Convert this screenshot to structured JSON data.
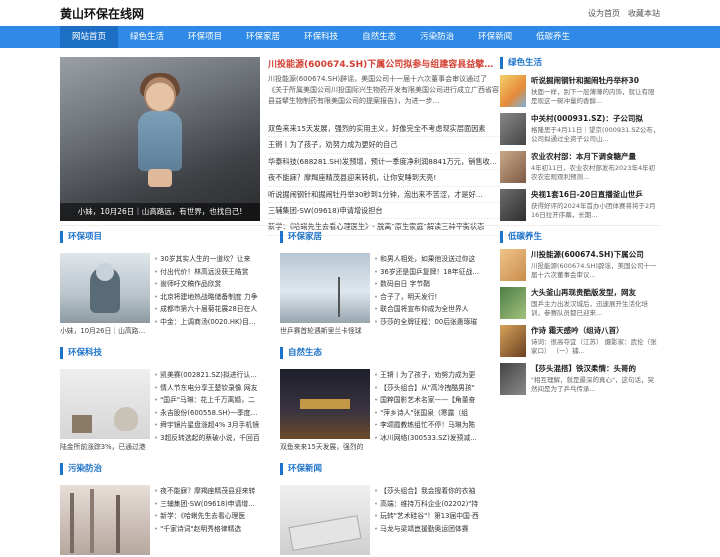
{
  "header": {
    "site_title": "黄山环保在线网",
    "links": [
      "设为首页",
      "收藏本站"
    ]
  },
  "nav": {
    "items": [
      "网站首页",
      "绿色生活",
      "环保项目",
      "环保家居",
      "环保科技",
      "自然生态",
      "污染防治",
      "环保新闻",
      "低碳养生"
    ],
    "active_index": 0
  },
  "featured": {
    "caption": "小妹，10月26日｜山高路远，有世界，也找自己!"
  },
  "headlines": {
    "title": "川投能源(600674.SH)下属公司拟参与组建容县益擘新...",
    "summary": "川投能源(600674.SH)辟谣，美国公司十一届十六次董事会审议通过了《关于所属美国公司川投国际兴生物药开发有限美国公司进行成立广西省容县益擘生物制药有限美国公司的提案报告》，为进一步...",
    "items": [
      "双鱼来来15天发展，强烈的实用主义，好像完全不考虑现实层面因素",
      "王锵丨为了孩子，劝努力成为更好的自己",
      "华泰科技(688281.SH)发预增，预计一季度净利润8841万元，销售收入...",
      "夜不能寐？摩羯座精茂县迎来转机，让你安睡到天亮!",
      "听说掘闹钢针和掘闹牡丹举30秒到1分钟，泡出来不苦涩，才是好...",
      "三辅集团-SW(09618)申请增设担台",
      "新学：《哈蜊先生去看心理医生》- 脱离\"原生家庭\"解读三种平衡状态"
    ]
  },
  "sidebar": {
    "heading": "绿色生活",
    "items": [
      {
        "title": "听说掘闹钢针和掘闹牡丹举杯30",
        "desc": "扶面一样，别下一层薄薄的内饰，就让有限是现这一碗冲量的香醇..."
      },
      {
        "title": "中关村(000931.SZ)：子公司拟",
        "desc": "格隆思于4月11日｜望京(000931.SZ公布，公司拟通过全资子公司山..."
      },
      {
        "title": "农业农村部：本月下调食糖产量",
        "desc": "4年初11日，农业农村部发布2023年4年初农农宏观观利预测..."
      },
      {
        "title": "央视1套16日-20日直播釜山世乒",
        "desc": "获得好评的2024年首办小团体赛将将于2月16日拉开序幕，长期..."
      }
    ]
  },
  "sections": {
    "huanbao_xiangmu": {
      "heading": "环保项目",
      "caption": "小妹，10月26日｜山高路远，",
      "items": [
        "30岁其实人生的一道坎？让来",
        "付出代价！林高远没获王皓赏",
        "崮师吁文稿作品欣赏",
        "北京将建地热战略储备制度 力争",
        "成都市第六十届菊花展28日在人",
        "中金：上调商汤(0020.HK)目标价"
      ]
    },
    "huanbao_jiaju": {
      "heading": "环保家居",
      "caption": "世乒赛首轮遇斯里兰卡怪球",
      "items": [
        "和男人相处，如果他没送过你这",
        "36岁还是国乒复牌！18年征战10",
        "数码自日 字节鞘",
        "合子了，明天发行!",
        "联合国将宣布仰成为全世界人",
        "莎莎的全牌征程：00后张惠琢璀"
      ]
    },
    "huanbao_keji": {
      "heading": "环保科技",
      "caption": "陆金所前涨踪3%，已通过港",
      "items": [
        "凯美赛(002821.SZ)拟进行认购有",
        "情人节东电分享王楚钦录像 网友",
        "\"国乒\"马琳：花上千万离婚，二",
        "永吉股份(600558.SH)一季度净利",
        "舜宇镜片星盘涨超4% 3月手机镜",
        "3超反转选起的蔡破小说，千回百"
      ]
    },
    "ziran_shengtai": {
      "heading": "自然生态",
      "caption": "双鱼来来15天发展，强烈的",
      "items": [
        "王锵丨为了孩子，劝努力成为更",
        "【莎头组合】从\"高冷拽酷男孩\"",
        "国粹国影艺术名家——【角董奋",
        "\"萍乡诗人\"张国泉（寒露（组",
        "李颂霞教练组忙不停！马琳为陈",
        "冰川网络(300533.SZ)发预减，预"
      ]
    },
    "wuran_fangzhi": {
      "heading": "污染防治",
      "caption": "",
      "items": [
        "夜不能寐？摩羯座精茂县迎来转",
        "三辅集团-SW(09618)申请增设租",
        "新学：《哈蜊先生去看心理医",
        "\"千家诗词\"赵明秀格律精选"
      ]
    },
    "huanbao_xinwen": {
      "heading": "环保新闻",
      "caption": "",
      "items": [
        "【莎头组合】我会搜着你的衣袖",
        "高端：维持万科企业(02202)\"持",
        "玩转\"艺术硅谷\"！第13届中国·西",
        "马龙与梁靖崑援勤奥运团体赛"
      ]
    }
  },
  "low_carbon": {
    "heading": "低碳养生",
    "items": [
      {
        "title": "川投能源(600674.SH)下属公司",
        "desc": "川投能源(600674.SH)辟谣，美国公司十一届十六次董事会审议..."
      },
      {
        "title": "大头釜山再现贵酷版发型，网友",
        "desc": "国乒主力出发汉城后，迅速展开生活化培训，参赛队员都已迎来..."
      },
      {
        "title": "作诗 霜天感吟（组诗八首）",
        "desc": "诗词：很高夺宜（江苏） 摄影家：武伦（张家口） （一）捕..."
      },
      {
        "title": "【莎头混搭】铁汉柔情：头哥的",
        "desc": "\"相互理解，就是最深的真心\"，这句话，突然间是为了乒乓传承..."
      }
    ]
  }
}
